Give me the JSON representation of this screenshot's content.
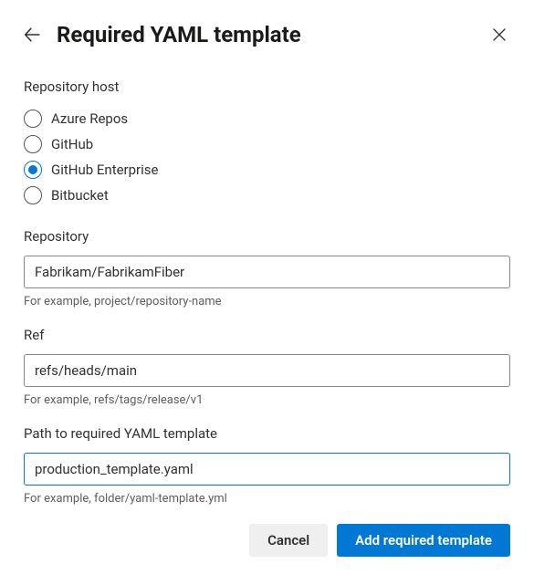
{
  "header": {
    "title": "Required YAML template"
  },
  "host": {
    "label": "Repository host",
    "options": [
      {
        "label": "Azure Repos",
        "selected": false
      },
      {
        "label": "GitHub",
        "selected": false
      },
      {
        "label": "GitHub Enterprise",
        "selected": true
      },
      {
        "label": "Bitbucket",
        "selected": false
      }
    ]
  },
  "repository": {
    "label": "Repository",
    "value": "Fabrikam/FabrikamFiber",
    "help": "For example, project/repository-name"
  },
  "ref": {
    "label": "Ref",
    "value": "refs/heads/main",
    "help": "For example, refs/tags/release/v1"
  },
  "path": {
    "label": "Path to required YAML template",
    "value": "production_template.yaml",
    "help": "For example, folder/yaml-template.yml"
  },
  "buttons": {
    "cancel": "Cancel",
    "submit": "Add required template"
  }
}
